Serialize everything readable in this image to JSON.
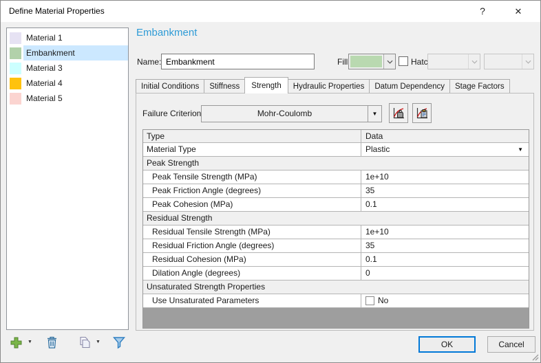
{
  "window": {
    "title": "Define Material Properties",
    "help_glyph": "?",
    "close_glyph": "✕"
  },
  "colors": {
    "accent": "#2e9bd6",
    "selection": "#cce8ff",
    "fill-swatch": "#b9d9b0",
    "ok-border": "#0078d7",
    "table-filler": "#9e9e9e"
  },
  "material_list": {
    "items": [
      {
        "label": "Material 1",
        "swatch": "#e6e2f3",
        "selected": false
      },
      {
        "label": "Embankment",
        "swatch": "#b2d1aa",
        "selected": true
      },
      {
        "label": "Material 3",
        "swatch": "#ccffff",
        "selected": false
      },
      {
        "label": "Material 4",
        "swatch": "#ffc20e",
        "selected": false
      },
      {
        "label": "Material 5",
        "swatch": "#fbd4d0",
        "selected": false
      }
    ]
  },
  "header": {
    "title": "Embankment"
  },
  "name_row": {
    "label": "Name:",
    "value": "Embankment",
    "fill_label": "Fill:",
    "hatch_label": "Hatch:",
    "hatch_checked": false
  },
  "tabs": {
    "items": [
      "Initial Conditions",
      "Stiffness",
      "Strength",
      "Hydraulic Properties",
      "Datum Dependency",
      "Stage Factors"
    ],
    "active": "Strength"
  },
  "strength_tab": {
    "failure_criterion_label": "Failure Criterion:",
    "failure_criterion_value": "Mohr-Coulomb",
    "icon_buttons": [
      "envelope-plot-button",
      "envelope-copy-button"
    ]
  },
  "property_table": {
    "columns": [
      "Type",
      "Data"
    ],
    "rows": [
      {
        "kind": "row",
        "label": "Material Type",
        "value": "Plastic",
        "control": "dropdown",
        "indent": false
      },
      {
        "kind": "section",
        "label": "Peak Strength"
      },
      {
        "kind": "row",
        "label": "Peak Tensile Strength (MPa)",
        "value": "1e+10",
        "indent": true
      },
      {
        "kind": "row",
        "label": "Peak Friction Angle (degrees)",
        "value": "35",
        "indent": true
      },
      {
        "kind": "row",
        "label": "Peak Cohesion (MPa)",
        "value": "0.1",
        "indent": true
      },
      {
        "kind": "section",
        "label": "Residual Strength"
      },
      {
        "kind": "row",
        "label": "Residual Tensile Strength (MPa)",
        "value": "1e+10",
        "indent": true
      },
      {
        "kind": "row",
        "label": "Residual Friction Angle (degrees)",
        "value": "35",
        "indent": true
      },
      {
        "kind": "row",
        "label": "Residual Cohesion (MPa)",
        "value": "0.1",
        "indent": true
      },
      {
        "kind": "row",
        "label": "Dilation Angle (degrees)",
        "value": "0",
        "indent": true
      },
      {
        "kind": "section",
        "label": "Unsaturated Strength Properties"
      },
      {
        "kind": "row",
        "label": "Use Unsaturated Parameters",
        "value": "No",
        "control": "checkbox",
        "indent": true
      }
    ]
  },
  "toolbar": {
    "icons": [
      "add-material",
      "add-material-dropdown",
      "delete-material",
      "copy-material",
      "copy-material-dropdown",
      "filter-materials"
    ]
  },
  "footer": {
    "ok_label": "OK",
    "cancel_label": "Cancel"
  }
}
